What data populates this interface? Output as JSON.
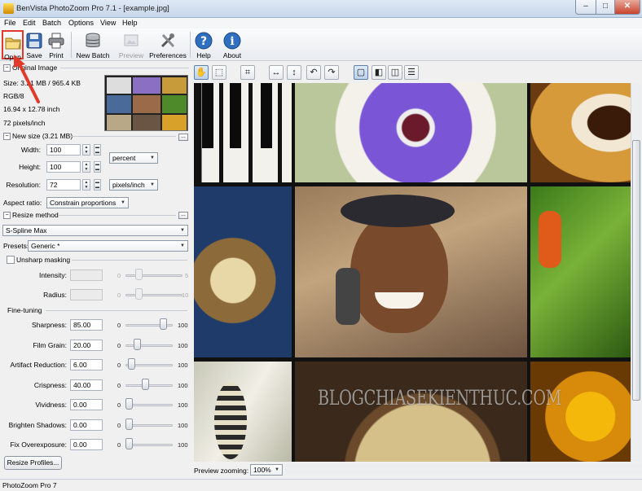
{
  "window": {
    "title": "BenVista PhotoZoom Pro 7.1 - [example.jpg]",
    "minimize": "–",
    "maximize": "□",
    "close": "✕"
  },
  "menu": [
    "File",
    "Edit",
    "Batch",
    "Options",
    "View",
    "Help"
  ],
  "toolbar": {
    "open": "Open",
    "save": "Save",
    "print": "Print",
    "new_batch": "New Batch",
    "preview": "Preview",
    "preferences": "Preferences",
    "help": "Help",
    "about": "About"
  },
  "original_image": {
    "header": "Original Image",
    "size": "Size: 3.21 MB / 965.4 KB",
    "mode": "RGB/8",
    "dimensions": "16.94 x 12.78 inch",
    "resolution": "72 pixels/inch"
  },
  "new_size": {
    "header": "New size (3.21 MB)",
    "width_label": "Width:",
    "width_value": "100",
    "height_label": "Height:",
    "height_value": "100",
    "unit": "percent",
    "resolution_label": "Resolution:",
    "resolution_value": "72",
    "resolution_unit": "pixels/inch",
    "aspect_label": "Aspect ratio:",
    "aspect_value": "Constrain proportions"
  },
  "resize_method": {
    "header": "Resize method",
    "method": "S-Spline Max",
    "presets_label": "Presets:",
    "presets_value": "Generic *"
  },
  "unsharp": {
    "label": "Unsharp masking",
    "intensity_label": "Intensity:",
    "intensity_min": "0",
    "intensity_max": "5",
    "radius_label": "Radius:",
    "radius_min": "0",
    "radius_max": "10"
  },
  "fine_tuning": {
    "header": "Fine-tuning",
    "items": [
      {
        "label": "Sharpness:",
        "value": "85.00",
        "min": "0",
        "max": "100",
        "level": 0.85
      },
      {
        "label": "Film Grain:",
        "value": "20.00",
        "min": "0",
        "max": "100",
        "level": 0.2
      },
      {
        "label": "Artifact Reduction:",
        "value": "6.00",
        "min": "0",
        "max": "100",
        "level": 0.06
      },
      {
        "label": "Crispness:",
        "value": "40.00",
        "min": "0",
        "max": "100",
        "level": 0.4
      },
      {
        "label": "Vividness:",
        "value": "0.00",
        "min": "0",
        "max": "100",
        "level": 0
      },
      {
        "label": "Brighten Shadows:",
        "value": "0.00",
        "min": "0",
        "max": "100",
        "level": 0
      },
      {
        "label": "Fix Overexposure:",
        "value": "0.00",
        "min": "0",
        "max": "100",
        "level": 0
      }
    ]
  },
  "resize_profiles": "Resize Profiles...",
  "preview_zoom": {
    "label": "Preview zooming:",
    "value": "100%"
  },
  "watermark": "BLOGCHIASEKIENTHUC.COM",
  "status": "PhotoZoom Pro 7",
  "icons": {
    "open": "folder-icon",
    "save": "floppy-icon",
    "print": "printer-icon",
    "help": "help-icon",
    "about": "info-icon"
  },
  "colors": {
    "highlight": "#e23a2a",
    "help_blue": "#2f6fbf"
  }
}
